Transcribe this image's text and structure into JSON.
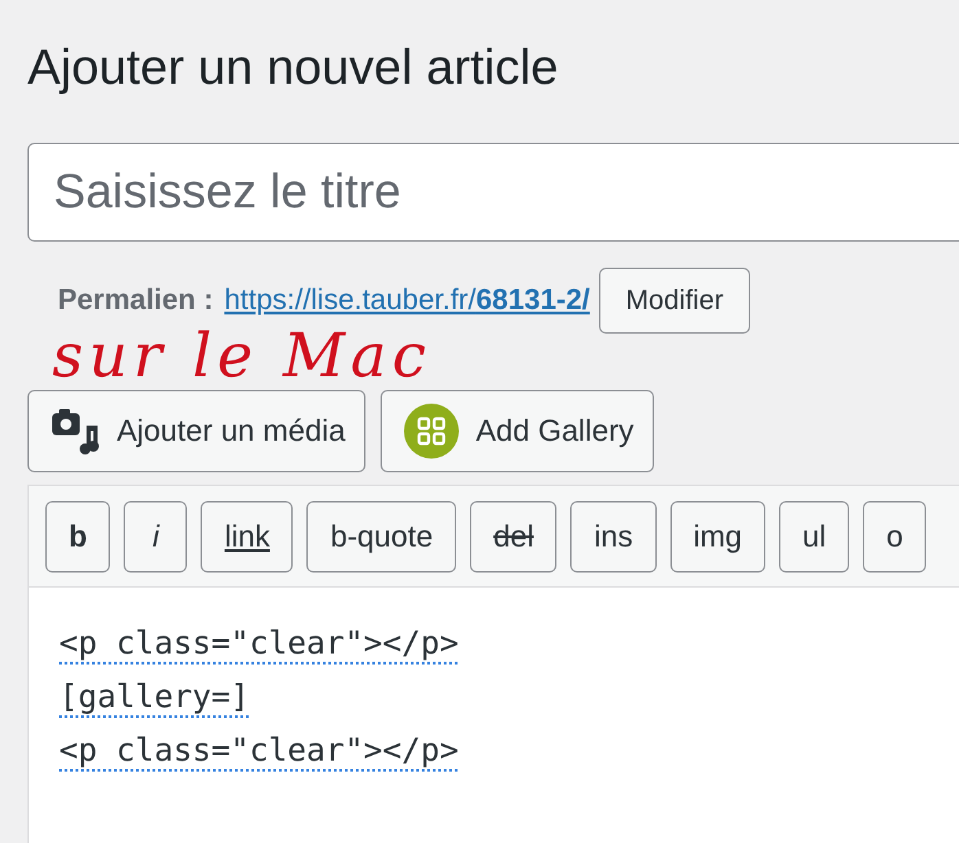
{
  "page_title": "Ajouter un nouvel article",
  "title_field": {
    "placeholder": "Saisissez le titre"
  },
  "permalink": {
    "label": "Permalien :",
    "url_base": "https://lise.tauber.fr/",
    "url_slug": "68131-2/",
    "button": "Modifier"
  },
  "annotation": "sur le Mac",
  "media_buttons": [
    {
      "label": "Ajouter un média",
      "kind": "media"
    },
    {
      "label": "Add Gallery",
      "kind": "gallery"
    }
  ],
  "toolbar": [
    {
      "label": "b",
      "kind": "bold"
    },
    {
      "label": "i",
      "kind": "italic"
    },
    {
      "label": "link",
      "kind": "link"
    },
    {
      "label": "b-quote",
      "kind": "plain"
    },
    {
      "label": "del",
      "kind": "del"
    },
    {
      "label": "ins",
      "kind": "plain"
    },
    {
      "label": "img",
      "kind": "plain"
    },
    {
      "label": "ul",
      "kind": "plain"
    },
    {
      "label": "o",
      "kind": "plain"
    }
  ],
  "code_lines": [
    {
      "text": "<p class=\"clear\"></p>",
      "flagged": true
    },
    {
      "text": "[gallery=]",
      "flagged": true
    },
    {
      "text": "<p class=\"clear\"></p>",
      "flagged": true
    }
  ]
}
